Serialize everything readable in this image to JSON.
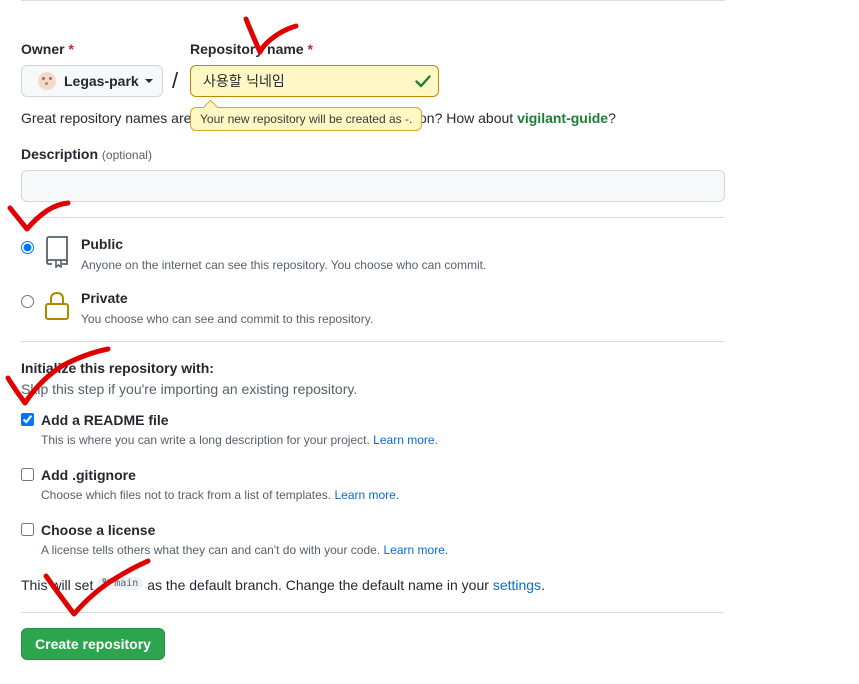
{
  "owner": {
    "label": "Owner",
    "required_mark": "*",
    "name": "Legas-park"
  },
  "repository": {
    "label": "Repository name",
    "required_mark": "*",
    "value": "사용할 닉네임",
    "tooltip": "Your new repository will be created as -."
  },
  "hint": {
    "prefix": "Great repository names are",
    "middle": "on? How about",
    "suggestion": "vigilant-guide",
    "suffix": "?"
  },
  "description": {
    "label": "Description",
    "optional": "(optional)",
    "value": ""
  },
  "visibility": {
    "selected": "public",
    "options": [
      {
        "id": "public",
        "title": "Public",
        "note": "Anyone on the internet can see this repository. You choose who can commit.",
        "icon": "repo-icon"
      },
      {
        "id": "private",
        "title": "Private",
        "note": "You choose who can see and commit to this repository.",
        "icon": "lock-icon"
      }
    ]
  },
  "initialize": {
    "heading": "Initialize this repository with:",
    "subheading": "Skip this step if you're importing an existing repository.",
    "options": [
      {
        "title": "Add a README file",
        "note": "This is where you can write a long description for your project.",
        "link": "Learn more.",
        "checked": true
      },
      {
        "title": "Add .gitignore",
        "note": "Choose which files not to track from a list of templates.",
        "link": "Learn more.",
        "checked": false
      },
      {
        "title": "Choose a license",
        "note": "A license tells others what they can and can't do with your code.",
        "link": "Learn more.",
        "checked": false
      }
    ]
  },
  "branch": {
    "prefix": "This will set",
    "name": "main",
    "middle": "as the default branch. Change the default name in your",
    "link": "settings",
    "suffix": "."
  },
  "create_button": "Create repository",
  "colors": {
    "accent_green": "#2da44e",
    "link_blue": "#0969da",
    "required_red": "#cf222e",
    "annotation_red": "#e00000"
  }
}
